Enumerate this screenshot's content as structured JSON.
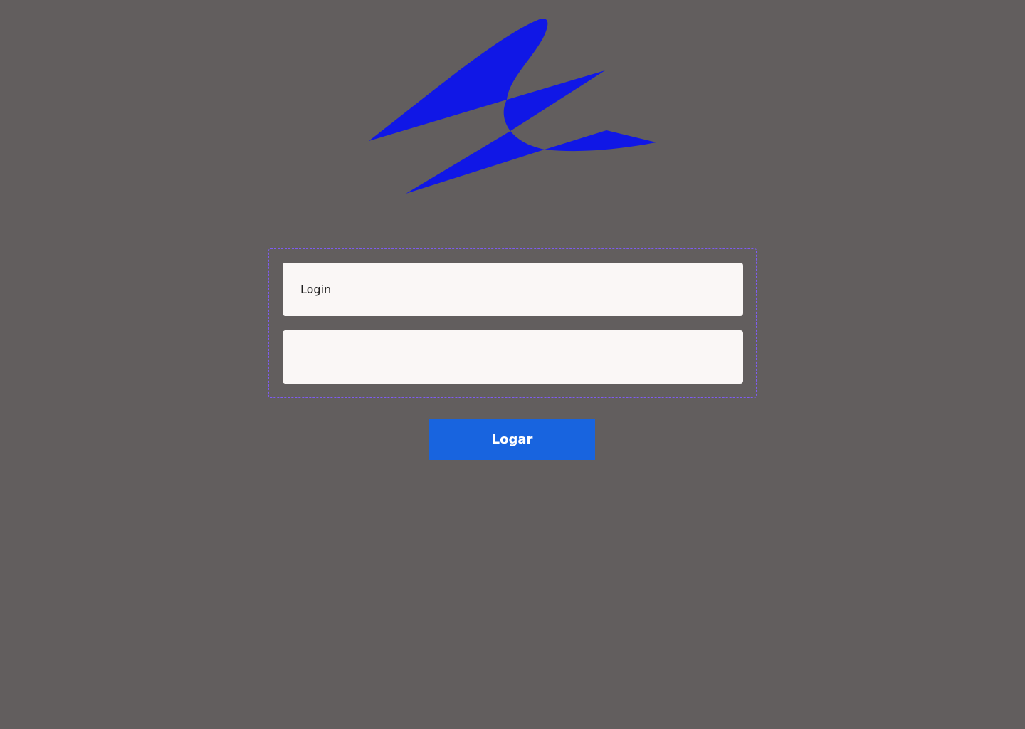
{
  "logo": {
    "icon": "swallow-bird-logo-icon",
    "color": "#1017e6"
  },
  "form": {
    "border_color": "#7f5cf2",
    "login_placeholder": "Login",
    "login_value": "",
    "password_placeholder": "",
    "password_value": ""
  },
  "submit": {
    "label": "Logar",
    "color": "#1864df"
  },
  "colors": {
    "background": "#625e5e",
    "field_background": "#faf7f6"
  }
}
